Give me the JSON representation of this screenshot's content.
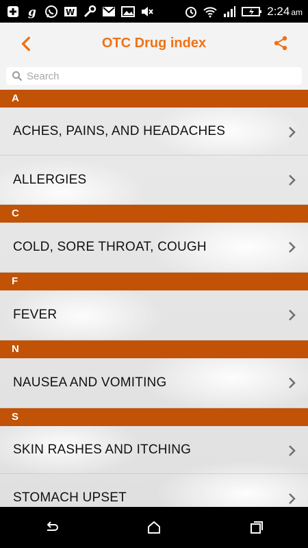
{
  "status_bar": {
    "time": "2:24",
    "ampm": "am",
    "icons": [
      "plus-box-icon",
      "g-icon",
      "whatsapp-icon",
      "w-icon",
      "wrench-icon",
      "gmail-icon",
      "image-icon",
      "mute-icon",
      "alarm-icon",
      "wifi-icon",
      "signal-icon",
      "battery-charging-icon"
    ]
  },
  "app_bar": {
    "title": "OTC Drug index",
    "accent_color": "#ef7215"
  },
  "search": {
    "placeholder": "Search"
  },
  "sections": [
    {
      "letter": "A",
      "items": [
        "ACHES, PAINS, AND HEADACHES",
        "ALLERGIES"
      ]
    },
    {
      "letter": "C",
      "items": [
        "COLD, SORE THROAT, COUGH"
      ]
    },
    {
      "letter": "F",
      "items": [
        "FEVER"
      ]
    },
    {
      "letter": "N",
      "items": [
        "NAUSEA AND VOMITING"
      ]
    },
    {
      "letter": "S",
      "items": [
        "SKIN RASHES AND ITCHING",
        "STOMACH UPSET"
      ]
    }
  ],
  "colors": {
    "section_header_bg": "#c15206",
    "section_header_text": "#ffffff"
  }
}
